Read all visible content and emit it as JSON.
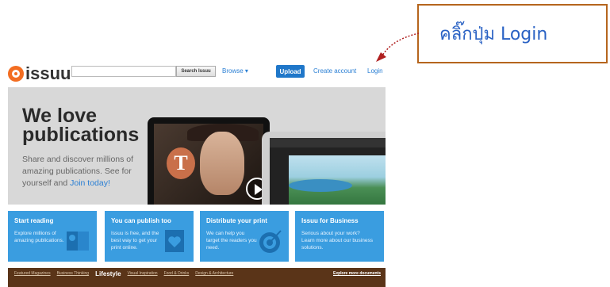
{
  "callout": {
    "text": "คลิ๊กปุ่ม Login"
  },
  "header": {
    "logo_text": "issuu",
    "search_placeholder": "",
    "search_button": "Search Issuu",
    "browse": "Browse ▾",
    "upload": "Upload",
    "create_account": "Create account",
    "login": "Login"
  },
  "hero": {
    "title": "We love publications",
    "subtitle": "Share and discover millions of amazing publications. See for yourself and ",
    "join": "Join today!",
    "nyt_glyph": "T"
  },
  "features": [
    {
      "title": "Start reading",
      "body": "Explore millions of amazing publications.",
      "icon": "book-icon"
    },
    {
      "title": "You can publish too",
      "body": "Issuu is free, and the best way to get your print online.",
      "icon": "publish-heart-icon"
    },
    {
      "title": "Distribute your print",
      "body": "We can help you target the readers you need.",
      "icon": "target-icon"
    },
    {
      "title": "Issuu for Business",
      "body": "Serious about your work? Learn more about our business solutions.",
      "icon": "business-icon"
    }
  ],
  "categories": {
    "items": [
      "Featured Magazines",
      "Business Thinking",
      "Lifestyle",
      "Visual Inspiration",
      "Food & Drinks",
      "Design & Architecture"
    ],
    "active_index": 2,
    "explore": "Explore more documents"
  },
  "colors": {
    "accent": "#2a7fd4",
    "logo": "#f36d21",
    "feature_bg": "#3a9de0",
    "callout_border": "#b5651d"
  }
}
